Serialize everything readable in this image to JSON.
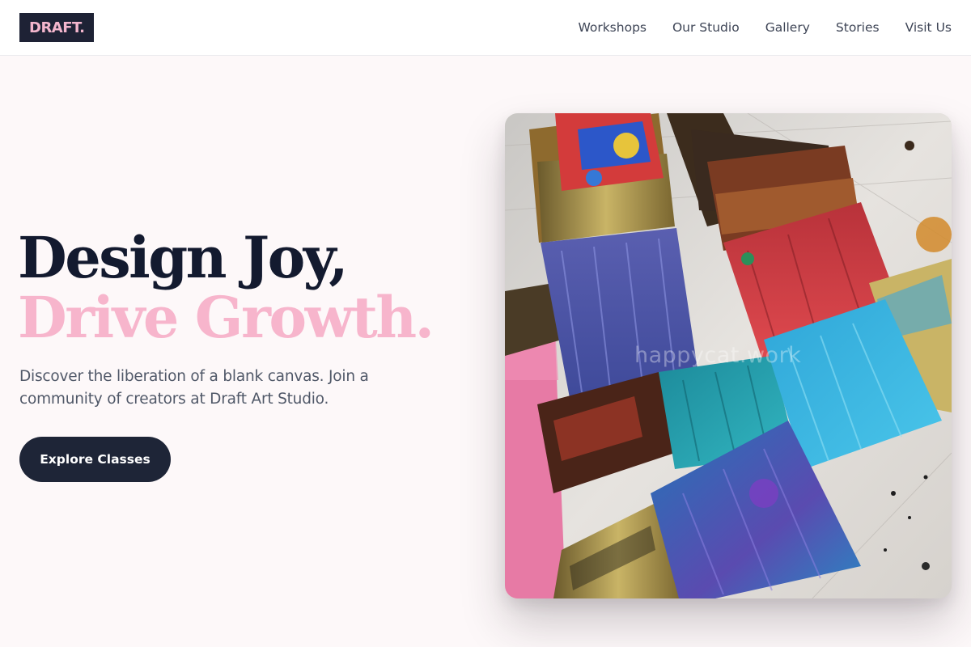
{
  "header": {
    "logo": "DRAFT.",
    "nav": [
      "Workshops",
      "Our Studio",
      "Gallery",
      "Stories",
      "Visit Us"
    ]
  },
  "hero": {
    "title_line_1": "Design Joy,",
    "title_line_2": "Drive Growth.",
    "description": "Discover the liberation of a blank canvas. Join a community of creators at Draft Art Studio.",
    "cta_label": "Explore Classes",
    "image_alt": "Paint-covered brushes",
    "watermark": "happycat.work"
  },
  "colors": {
    "page_background": "#fdf8f9",
    "dark": "#1e2537",
    "accent_pink": "#f7b5cc"
  }
}
